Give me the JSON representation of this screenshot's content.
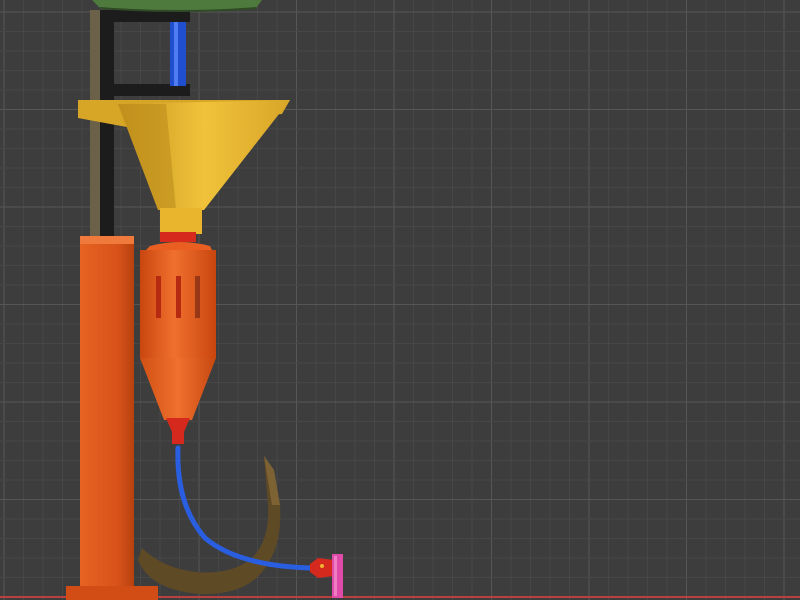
{
  "viewport": {
    "background_color": "#3d3d3d",
    "grid_minor_color": "#474747",
    "grid_major_color": "#565656",
    "x_axis_color": "#b8403f"
  },
  "scene": {
    "objects": [
      {
        "name": "top-plate",
        "color": "#4f7a3e"
      },
      {
        "name": "black-frame",
        "color": "#1c1c1c"
      },
      {
        "name": "back-rail",
        "color": "#6b6149"
      },
      {
        "name": "blue-feed-tube",
        "color": "#1f4fcf"
      },
      {
        "name": "yellow-hopper",
        "color": "#e8b52c"
      },
      {
        "name": "orange-column",
        "color": "#e0561a"
      },
      {
        "name": "orange-motor-housing",
        "color": "#ec6626"
      },
      {
        "name": "red-coupling",
        "color": "#d4291c"
      },
      {
        "name": "brown-hook-arm",
        "color": "#5f4a26"
      },
      {
        "name": "blue-outlet-hose",
        "color": "#2a5ee0"
      },
      {
        "name": "red-nozzle",
        "color": "#d4291c"
      },
      {
        "name": "pink-end-cap",
        "color": "#e04aa8"
      }
    ]
  }
}
